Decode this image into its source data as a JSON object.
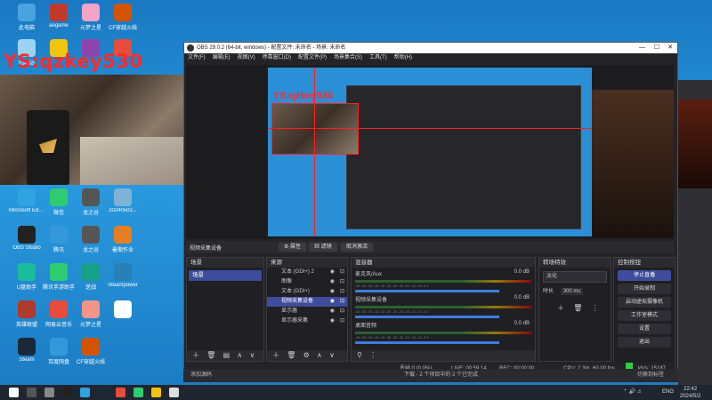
{
  "watermark": "YS:qzkey530",
  "desktop_icons": [
    {
      "label": "此电脑",
      "color": "#4aa3df"
    },
    {
      "label": "aegame",
      "color": "#c0392b"
    },
    {
      "label": "元梦之星",
      "color": "#f5a3c8"
    },
    {
      "label": "CF穿越火线",
      "color": "#d35400"
    },
    {
      "label": "回收站",
      "color": "#9bd3f0"
    },
    {
      "label": "",
      "color": "#f1c40f"
    },
    {
      "label": "",
      "color": "#8e44ad"
    },
    {
      "label": "",
      "color": "#e74c3c"
    },
    {
      "label": "Microsoft Edge",
      "color": "#2ea4e0"
    },
    {
      "label": "微信",
      "color": "#2ecc71"
    },
    {
      "label": "龙之谷",
      "color": "#555"
    },
    {
      "label": "20240502...",
      "color": "#7fb3d5"
    },
    {
      "label": "OBS Studio",
      "color": "#222"
    },
    {
      "label": "腾讯",
      "color": "#3498db"
    },
    {
      "label": "龙之谷",
      "color": "#555"
    },
    {
      "label": "暑期作业",
      "color": "#e67e22"
    },
    {
      "label": "U盘助手",
      "color": "#1abc9c"
    },
    {
      "label": "腾讯手游助手",
      "color": "#2ecc71"
    },
    {
      "label": "逆战",
      "color": "#16a085"
    },
    {
      "label": "Steampower",
      "color": "#2980b9"
    },
    {
      "label": "英雄联盟",
      "color": "#b03a2e"
    },
    {
      "label": "网易云音乐",
      "color": "#e74c3c"
    },
    {
      "label": "元梦之星",
      "color": "#f1948a"
    },
    {
      "label": "",
      "color": "#fff"
    },
    {
      "label": "Steam",
      "color": "#1b2838"
    },
    {
      "label": "百度网盘",
      "color": "#3498db"
    },
    {
      "label": "CF穿越火线",
      "color": "#d35400"
    }
  ],
  "obs": {
    "title": "OBS 29.0.2 (64-bit, windows) - 配置文件: 未命名 - 场景: 未命名",
    "menu": [
      "文件(F)",
      "编辑(E)",
      "视图(V)",
      "停靠窗口(D)",
      "配置文件(P)",
      "场景集合(S)",
      "工具(T)",
      "帮助(H)"
    ],
    "toolbar": {
      "label": "视频采集设备",
      "props": "⚙ 属性",
      "filters": "▦ 滤镜",
      "deactivate": "取消激活"
    },
    "scenes": {
      "title": "场景",
      "items": [
        "场景"
      ]
    },
    "sources": {
      "title": "来源",
      "items": [
        {
          "label": "文本 (GDI+) 2",
          "selected": false
        },
        {
          "label": "图像",
          "selected": false
        },
        {
          "label": "文本 (GDI+)",
          "selected": false
        },
        {
          "label": "视频采集设备",
          "selected": true
        },
        {
          "label": "显示器",
          "selected": false
        },
        {
          "label": "显示器采集",
          "selected": false
        }
      ]
    },
    "mixer": {
      "title": "混音器",
      "channels": [
        {
          "name": "麦克风/Aux",
          "db": "0.0 dB"
        },
        {
          "name": "视频采集设备",
          "db": "0.0 dB"
        },
        {
          "name": "桌面音频",
          "db": "0.0 dB"
        }
      ],
      "scale": "-60 -55 -50 -45 -40 -35 -30 -25 -20 -15 -10 -5 0"
    },
    "transitions": {
      "title": "转场特效",
      "type": "淡化",
      "duration_label": "时长",
      "duration": "300 ms"
    },
    "controls": {
      "title": "控制按钮",
      "buttons": [
        "停止直播",
        "开始录制",
        "启动虚拟摄像机",
        "工作室模式",
        "设置",
        "退出"
      ]
    },
    "status": {
      "dropped": "丢帧 0 (0.0%)",
      "live": "LIVE: 00:59:14",
      "rec": "REC: 00:00:00",
      "cpu": "CPU: 2.3%, 60.00 fps",
      "kbps": "kb/s: 15187"
    },
    "bottom_bar": {
      "left": "添加源码",
      "center": "下载 - 2 个项目中的 2 个已完成",
      "right": "切换到标签"
    }
  },
  "taskbar": {
    "icons": [
      "windows-start",
      "search",
      "task-view",
      "obs",
      "edge",
      "steam",
      "netease",
      "wechat",
      "explorer",
      "file"
    ],
    "tray": {
      "lang": "ENG",
      "time": "22:42",
      "date": "2024/5/2"
    }
  }
}
